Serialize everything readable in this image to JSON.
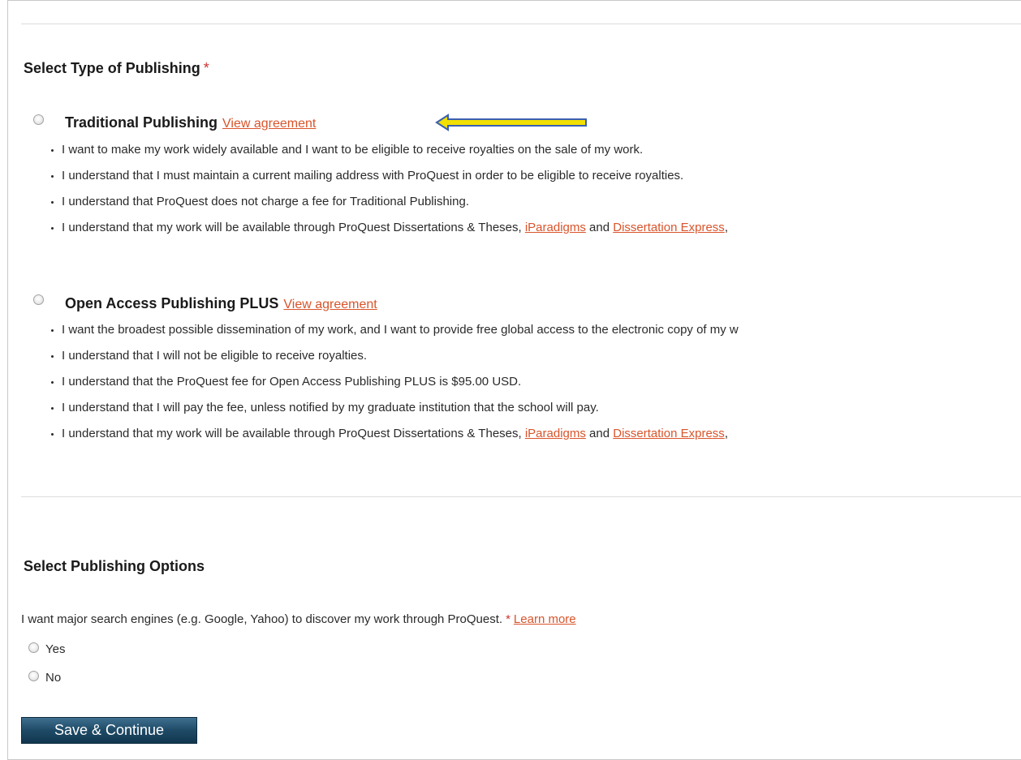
{
  "type_section": {
    "title": "Select Type of Publishing",
    "required_mark": "*"
  },
  "options": [
    {
      "title": "Traditional Publishing",
      "link": "View agreement",
      "bullets": [
        "I want to make my work widely available and I want to be eligible to receive royalties on the sale of my work.",
        "I understand that I must maintain a current mailing address with ProQuest in order to be eligible to receive royalties.",
        "I understand that ProQuest does not charge a fee for Traditional Publishing."
      ],
      "last_bullet": {
        "text": "I understand that my work will be available through ProQuest Dissertations & Theses,",
        "link1": "iParadigms",
        "and": "and",
        "link2": "Dissertation Express",
        "tail": ","
      }
    },
    {
      "title": "Open Access Publishing PLUS",
      "link": "View agreement",
      "bullets": [
        "I want the broadest possible dissemination of my work, and I want to provide free global access to the electronic copy of my w",
        "I understand that I will not be eligible to receive royalties.",
        "I understand that the ProQuest fee for Open Access Publishing PLUS is $95.00 USD.",
        "I understand that I will pay the fee, unless notified by my graduate institution that the school will pay."
      ],
      "last_bullet": {
        "text": "I understand that my work will be available through ProQuest Dissertations & Theses,",
        "link1": "iParadigms",
        "and": "and",
        "link2": "Dissertation Express",
        "tail": ","
      }
    }
  ],
  "options_section": {
    "title": "Select Publishing Options",
    "question": "I want major search engines (e.g. Google, Yahoo) to discover my work through ProQuest.",
    "required_mark": "*",
    "learn_more": "Learn more",
    "choices": [
      "Yes",
      "No"
    ]
  },
  "save_button": "Save & Continue",
  "colors": {
    "link": "#d9542b",
    "required": "#cc3333",
    "button": "#1e4a66",
    "arrow_fill": "#f2e000",
    "arrow_stroke": "#3a5fb0"
  },
  "annotation": {
    "icon": "left-arrow-icon"
  }
}
